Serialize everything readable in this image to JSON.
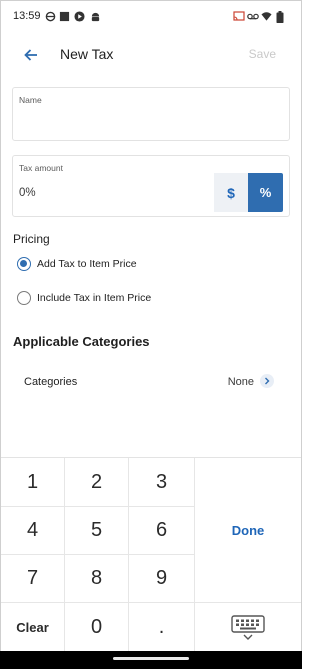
{
  "status_bar": {
    "time": "13:59",
    "left_icons": [
      "settings-icon",
      "square-icon",
      "play-icon",
      "android-icon"
    ],
    "right_icons": [
      "cast-icon",
      "voicemail-icon",
      "wifi-icon",
      "battery-icon"
    ]
  },
  "app_bar": {
    "back_icon": "back-arrow-icon",
    "title": "New Tax",
    "save_label": "Save"
  },
  "form": {
    "name_label": "Name",
    "name_value": "",
    "tax_amount_label": "Tax amount",
    "tax_amount_value": "0%",
    "unit_dollar": "$",
    "unit_percent": "%",
    "selected_unit": "%"
  },
  "pricing": {
    "label": "Pricing",
    "options": [
      {
        "label": "Add Tax to Item Price",
        "checked": true
      },
      {
        "label": "Include Tax in Item Price",
        "checked": false
      }
    ]
  },
  "categories": {
    "heading": "Applicable Categories",
    "row_label": "Categories",
    "row_value": "None"
  },
  "keypad": {
    "digits": [
      "1",
      "2",
      "3",
      "4",
      "5",
      "6",
      "7",
      "8",
      "9"
    ],
    "clear_label": "Clear",
    "zero_label": "0",
    "dot_label": ".",
    "done_label": "Done",
    "keyboard_icon": "keyboard-icon"
  },
  "colors": {
    "accent": "#2f6db0",
    "accent_text": "#1f66b8",
    "toggle_off_bg": "#eef1f5",
    "save_disabled": "#c9c9c9"
  }
}
